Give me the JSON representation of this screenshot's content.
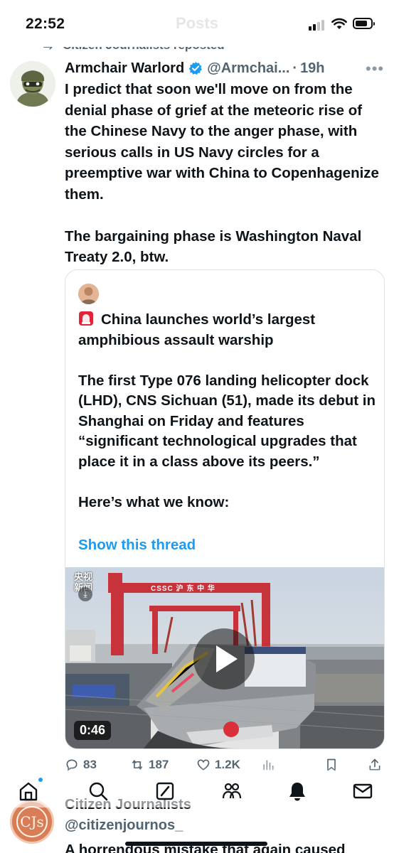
{
  "status_bar": {
    "time": "22:52",
    "page_title": "Posts"
  },
  "repost": {
    "label": "Citizen Journalists reposted"
  },
  "tweet": {
    "author_name": "Armchair Warlord",
    "handle": "@Armchai...",
    "separator": "·",
    "time": "19h",
    "text": "I predict that soon we'll move on from the denial phase of grief at the meteoric rise of the Chinese Navy to the anger phase, with serious calls in US Navy circles for a preemptive war with China to Copenhagenize them.\n\nThe bargaining phase is Washington Naval Treaty 2.0, btw."
  },
  "quote": {
    "text": "China launches world’s largest amphibious assault warship\n\nThe first Type 076 landing helicopter dock (LHD), CNS Sichuan (51), made its debut in Shanghai on Friday and features “significant technological upgrades that place it in a class above its peers.”\n\nHere’s what we know:",
    "show_thread": "Show this thread",
    "video": {
      "duration": "0:46",
      "logo_line1": "央视",
      "logo_line2": "新闻",
      "crane_sign": "CSSC 沪 东 中 华"
    }
  },
  "actions": {
    "replies": "83",
    "reposts": "187",
    "likes": "1.2K"
  },
  "next_tweet": {
    "author_name": "Citizen Journalists",
    "handle": "@citizenjournos_",
    "avatar_text": "CJs",
    "text": "A horrendous mistake that again caused"
  },
  "colors": {
    "accent": "#1d9bf0",
    "secondary_text": "#536471",
    "primary_text": "#0f1419",
    "crane_red": "#c8323a"
  }
}
